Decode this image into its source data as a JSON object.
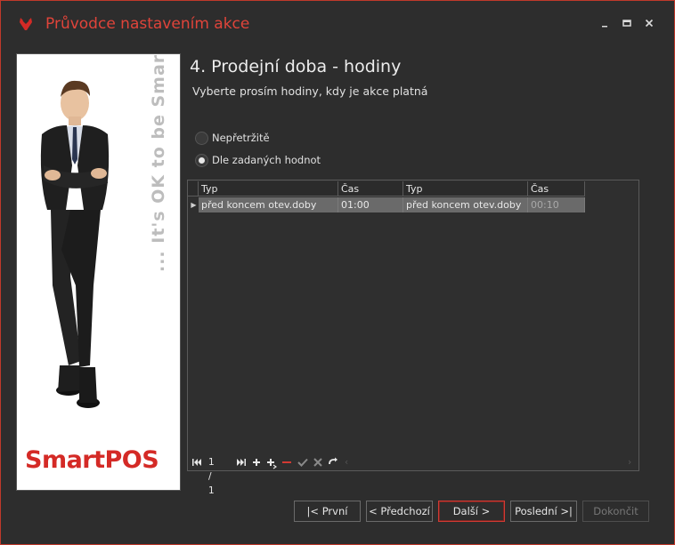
{
  "window": {
    "title": "Průvodce nastavením akce",
    "controls": [
      "minimize-icon",
      "maximize-icon",
      "close-icon"
    ],
    "accent": "#e0443a"
  },
  "side_panel": {
    "slogan": "... It's OK to be Smart",
    "logo_text": "SmartPOS",
    "logo_color": "#d42a26"
  },
  "step": {
    "title": "4. Prodejní doba - hodiny",
    "subtitle": "Vyberte prosím hodiny, kdy je akce platná"
  },
  "options": [
    {
      "label": "Nepřetržitě",
      "checked": false
    },
    {
      "label": "Dle zadaných hodnot",
      "checked": true
    }
  ],
  "grid": {
    "columns": [
      "Typ",
      "Čas",
      "Typ",
      "Čas"
    ],
    "rows": [
      [
        "před koncem otev.doby",
        "01:00",
        "před koncem otev.doby",
        "00:10"
      ]
    ],
    "navigator": {
      "record_info": "1 / 1",
      "icons": [
        "first-record-icon",
        "next-record-icon",
        "last-record-icon",
        "add-icon",
        "insert-icon",
        "delete-icon",
        "confirm-icon",
        "cancel-icon",
        "refresh-icon"
      ]
    }
  },
  "buttons": {
    "first": "|< První",
    "prev": "< Předchozí",
    "next": "Další >",
    "last": "Poslední >|",
    "finish": "Dokončit"
  }
}
